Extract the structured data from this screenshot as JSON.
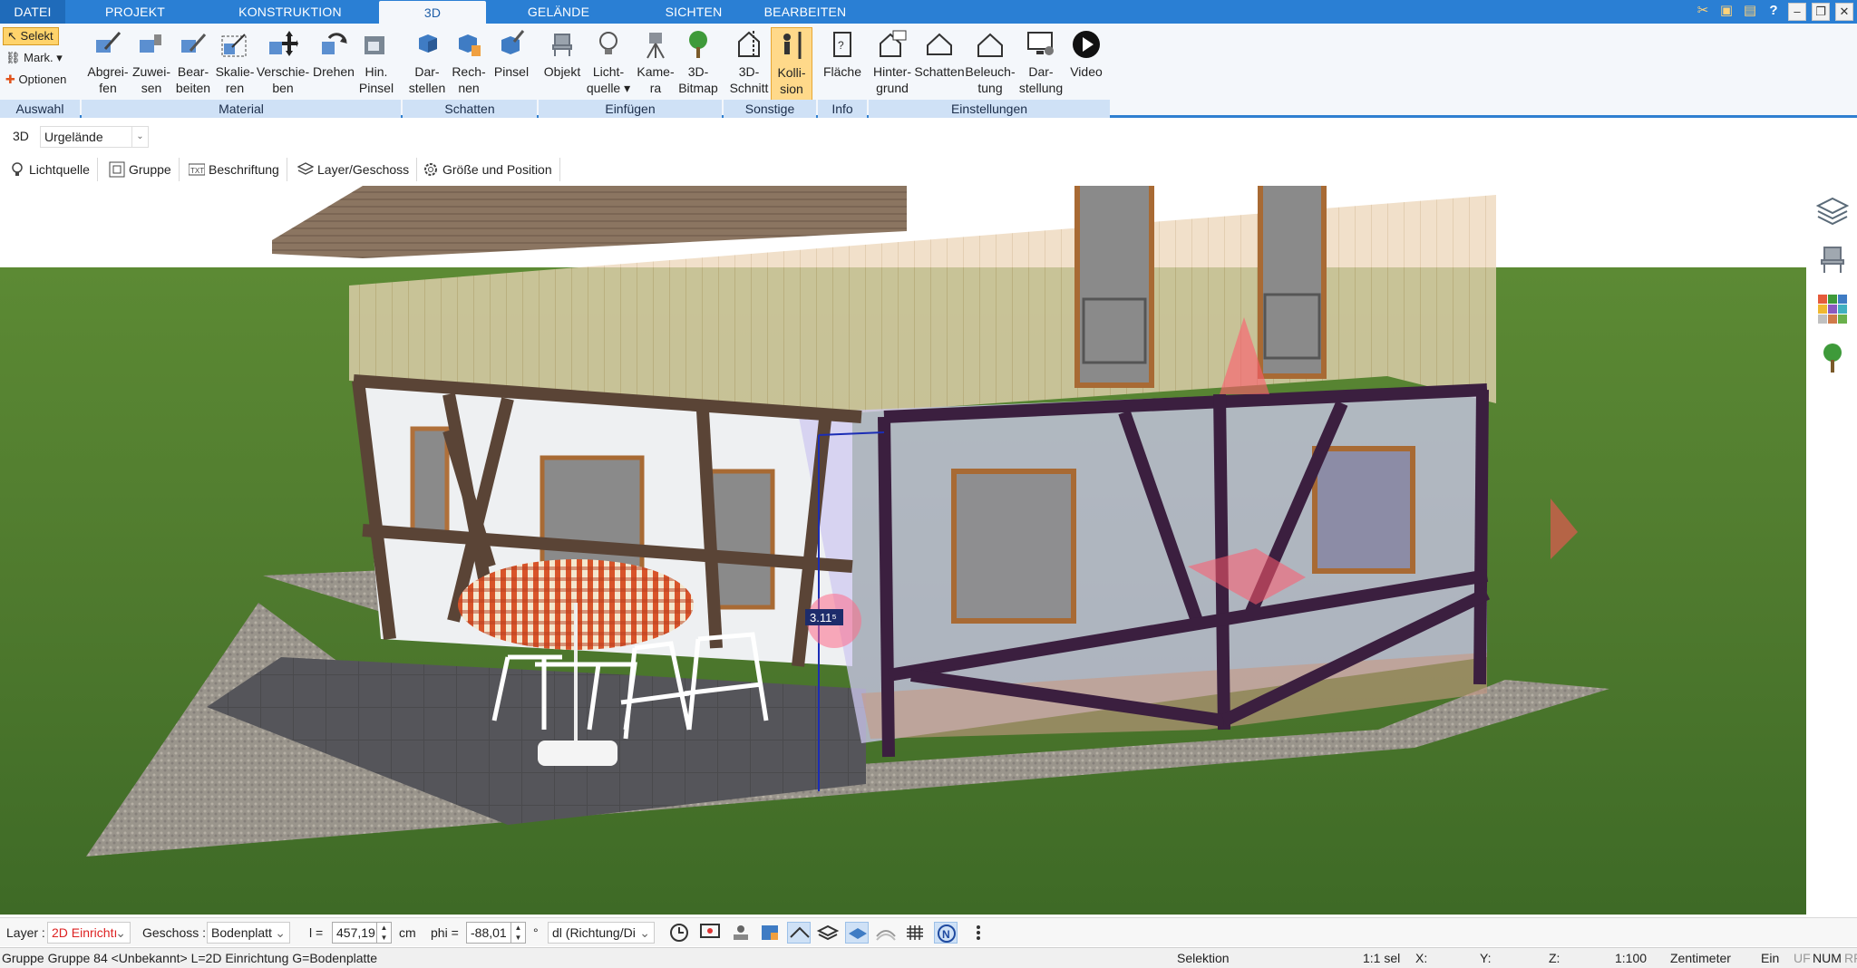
{
  "tabs": [
    {
      "label": "DATEI"
    },
    {
      "label": "PROJEKT"
    },
    {
      "label": "KONSTRUKTION"
    },
    {
      "label": "3D"
    },
    {
      "label": "GELÄNDE"
    },
    {
      "label": "SICHTEN"
    },
    {
      "label": "BEARBEITEN"
    }
  ],
  "ribbon": {
    "auswahl": {
      "select": "Selekt",
      "mark": "Mark.",
      "options": "Optionen",
      "group": "Auswahl"
    },
    "material": {
      "group": "Material",
      "buttons": [
        {
          "line1": "Abgrei-",
          "line2": "fen"
        },
        {
          "line1": "Zuwei-",
          "line2": "sen"
        },
        {
          "line1": "Bear-",
          "line2": "beiten"
        },
        {
          "line1": "Skalie-",
          "line2": "ren"
        },
        {
          "line1": "Verschie-",
          "line2": "ben"
        },
        {
          "line1": "Drehen",
          "line2": ""
        },
        {
          "line1": "Hin.",
          "line2": "Pinsel"
        }
      ]
    },
    "schatten": {
      "group": "Schatten",
      "buttons": [
        {
          "line1": "Dar-",
          "line2": "stellen"
        },
        {
          "line1": "Rech-",
          "line2": "nen"
        },
        {
          "line1": "Pinsel",
          "line2": ""
        }
      ]
    },
    "einfuegen": {
      "group": "Einfügen",
      "buttons": [
        {
          "line1": "Objekt",
          "line2": ""
        },
        {
          "line1": "Licht-",
          "line2": "quelle ▾"
        },
        {
          "line1": "Kame-",
          "line2": "ra"
        },
        {
          "line1": "3D-",
          "line2": "Bitmap"
        }
      ]
    },
    "sonstige": {
      "group": "Sonstige",
      "buttons": [
        {
          "line1": "3D-",
          "line2": "Schnitt"
        },
        {
          "line1": "Kolli-",
          "line2": "sion"
        }
      ]
    },
    "info": {
      "group": "Info",
      "buttons": [
        {
          "line1": "Fläche",
          "line2": ""
        }
      ]
    },
    "einstellungen": {
      "group": "Einstellungen",
      "buttons": [
        {
          "line1": "Hinter-",
          "line2": "grund"
        },
        {
          "line1": "Schatten",
          "line2": ""
        },
        {
          "line1": "Beleuch-",
          "line2": "tung"
        },
        {
          "line1": "Dar-",
          "line2": "stellung"
        },
        {
          "line1": "Video",
          "line2": ""
        }
      ]
    }
  },
  "view": {
    "label": "3D",
    "selected": "Urgelände"
  },
  "toolrow": [
    {
      "label": "Lichtquelle"
    },
    {
      "label": "Gruppe"
    },
    {
      "label": "Beschriftung"
    },
    {
      "label": "Layer/Geschoss"
    },
    {
      "label": "Größe und Position"
    }
  ],
  "viewport": {
    "dimension_label": "3.11⁵"
  },
  "inputbar": {
    "layer_label": "Layer :",
    "layer_value": "2D Einrichtı",
    "geschoss_label": "Geschoss :",
    "geschoss_value": "Bodenplatt",
    "l_label": "l =",
    "l_value": "457,19",
    "l_unit": "cm",
    "phi_label": "phi =",
    "phi_value": "-88,01",
    "phi_unit": "°",
    "mode_value": "dl (Richtung/Di"
  },
  "statusbar": {
    "info": "Gruppe Gruppe 84 <Unbekannt> L=2D Einrichtung G=Bodenplatte",
    "mode": "Selektion",
    "sel": "1:1 sel",
    "x": "X:",
    "y": "Y:",
    "z": "Z:",
    "scale": "1:100",
    "unit": "Zentimeter",
    "ein": "Ein",
    "uf": "UF",
    "num": "NUM",
    "rf": "RF"
  },
  "colors": {
    "accent": "#2a7fd4",
    "ribbon_bg": "#f4f7fb",
    "active_btn": "#ffd98a",
    "beam": "#3b1f3f",
    "lawn": "#4f7a2e"
  }
}
